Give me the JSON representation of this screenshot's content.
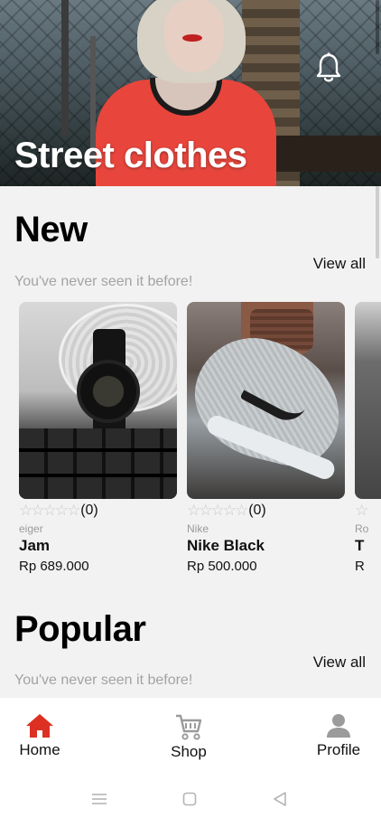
{
  "hero": {
    "title": "Street clothes",
    "notification_icon": "bell-icon"
  },
  "sections": [
    {
      "title": "New",
      "view_all": "View all",
      "subtitle": "You've never seen it before!"
    },
    {
      "title": "Popular",
      "view_all": "View all",
      "subtitle": "You've never seen it before!"
    }
  ],
  "products": [
    {
      "brand": "eiger",
      "name": "Jam",
      "price": "Rp 689.000",
      "stars": "☆☆☆☆☆",
      "rating_count": "(0)"
    },
    {
      "brand": "Nike",
      "name": "Nike Black",
      "price": "Rp 500.000",
      "stars": "☆☆☆☆☆",
      "rating_count": "(0)"
    },
    {
      "brand": "Ro",
      "name": "T",
      "price": "R",
      "stars": "☆",
      "rating_count": ""
    }
  ],
  "bottom_nav": [
    {
      "label": "Home",
      "icon": "home-icon",
      "active": true,
      "color": "#db3022"
    },
    {
      "label": "Shop",
      "icon": "cart-icon",
      "active": false,
      "color": "#9b9b9b"
    },
    {
      "label": "Profile",
      "icon": "profile-icon",
      "active": false,
      "color": "#9b9b9b"
    }
  ],
  "system_nav": [
    "menu-icon",
    "home-square-icon",
    "back-triangle-icon"
  ]
}
